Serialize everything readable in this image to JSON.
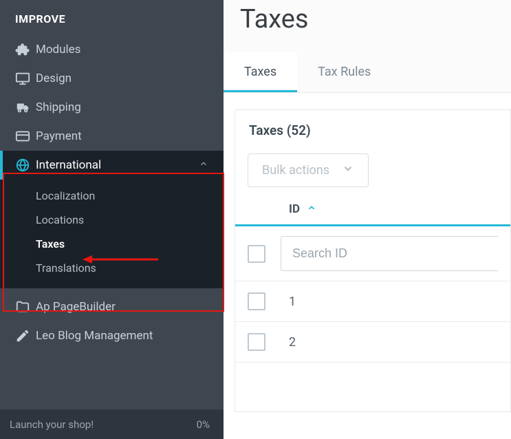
{
  "sidebar": {
    "section_title": "IMPROVE",
    "items": {
      "modules": "Modules",
      "design": "Design",
      "shipping": "Shipping",
      "payment": "Payment",
      "international": "International",
      "ap_pagebuilder": "Ap PageBuilder",
      "leo_blog": "Leo Blog Management"
    },
    "submenu": {
      "localization": "Localization",
      "locations": "Locations",
      "taxes": "Taxes",
      "translations": "Translations"
    },
    "launch_label": "Launch your shop!",
    "launch_pct": "0%"
  },
  "main": {
    "title": "Taxes",
    "tabs": {
      "taxes": "Taxes",
      "tax_rules": "Tax Rules"
    },
    "panel_title": "Taxes (52)",
    "bulk_label": "Bulk actions",
    "col_id": "ID",
    "search_placeholder": "Search ID",
    "rows": {
      "r1": "1",
      "r2": "2"
    }
  },
  "colors": {
    "accent": "#25b9d7",
    "highlight": "#e61610"
  }
}
